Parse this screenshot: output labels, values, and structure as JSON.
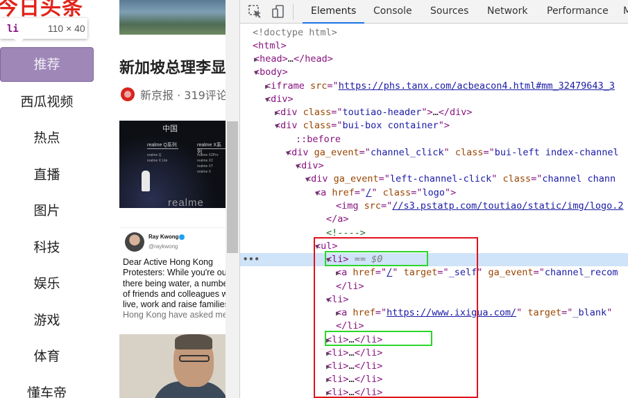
{
  "page": {
    "logo_fragment": "今日头条",
    "tooltip": {
      "tag": "li",
      "dims": "110 × 40"
    },
    "channels": [
      "推荐",
      "西瓜视频",
      "热点",
      "直播",
      "图片",
      "科技",
      "娱乐",
      "游戏",
      "体育",
      "懂车帝"
    ],
    "feed": {
      "headline": "新加坡总理李显",
      "meta": "新京报 · 319评论",
      "realme": {
        "title": "中国",
        "q_label": "realme Q系列",
        "x_label": "realme X系列",
        "q_specs": [
          "realme Q",
          "realme X Lite"
        ],
        "x_specs": [
          "realme X2Pro",
          "realme X2",
          "realme XT",
          "realme X"
        ],
        "brand": "realme"
      },
      "tweet": {
        "name": "Ray Kwong",
        "handle": "@raykwong",
        "lines": [
          "Dear Active Hong Kong",
          "Protesters: While you're out",
          "there being water, a number",
          "of friends and colleagues w",
          "live, work and raise families",
          "Hong Kong have asked me"
        ]
      }
    }
  },
  "devtools": {
    "tabs": [
      "Elements",
      "Console",
      "Sources",
      "Network",
      "Performance",
      "M"
    ],
    "active_tab": "Elements",
    "tree": {
      "doctype": "<!doctype html>",
      "html": "html",
      "head": "head",
      "body": "body",
      "iframe_src": "https://phs.tanx.com/acbeacon4.html#mm_32479643_3",
      "div": "div",
      "header_class": "toutiao-header",
      "container_class": "bui-box container",
      "before": "::before",
      "ga_channel_click": "channel_click",
      "bui_left_class": "bui-left index-channel",
      "ga_left_channel": "left-channel-click",
      "channel_class": "channel chann",
      "logo_href": "/",
      "logo_class": "logo",
      "img_src": "//s3.pstatp.com/toutiao/static/img/logo.2",
      "comment": "<!---->",
      "ul": "ul",
      "li": "li",
      "eq_sel": "== $0",
      "a1_href": "/",
      "a1_target": "_self",
      "a1_ga": "channel_recom",
      "a2_href": "https://www.ixigua.com/",
      "a2_target": "_blank",
      "ellipsis": "…"
    }
  },
  "colors": {
    "highlight_red": "#e0121a",
    "highlight_green": "#2bd62b",
    "selected_row": "#cfe3f9",
    "tag": "#881280",
    "attr_name": "#994500",
    "attr_value": "#1a1aa6",
    "active_channel": "#9f87b8",
    "logo_red": "#e2231a"
  }
}
